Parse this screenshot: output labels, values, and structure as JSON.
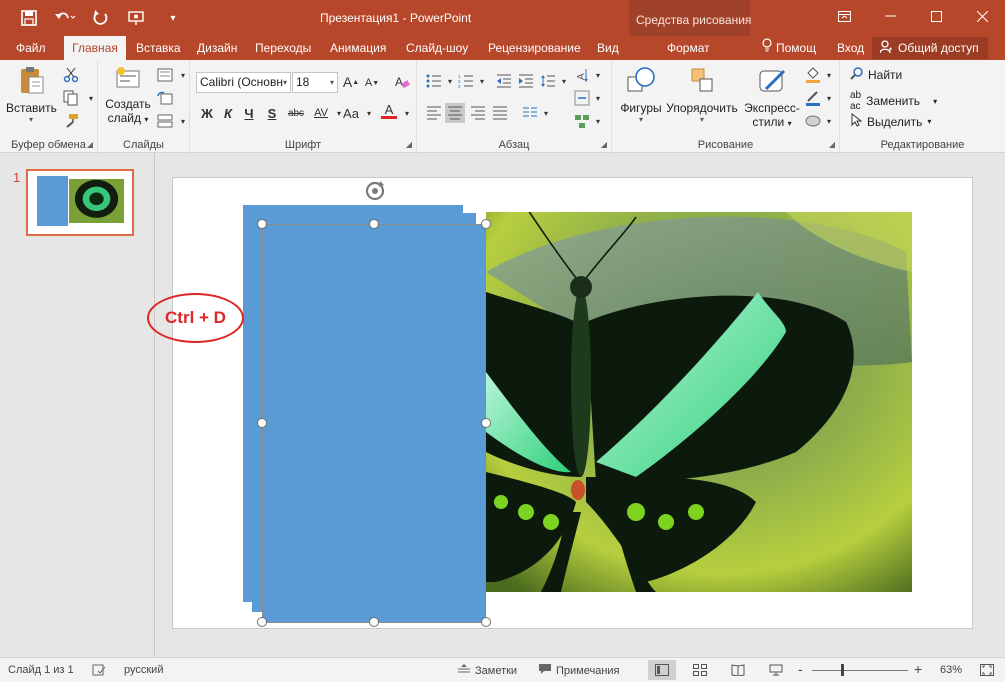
{
  "app": {
    "title": "Презентация1 - PowerPoint",
    "context_group_title": "Средства рисования",
    "accent_color": "#b7472a"
  },
  "qat": {
    "icons": [
      "save-icon",
      "undo-icon",
      "redo-icon",
      "start-from-beginning-icon",
      "customize-qat-icon"
    ]
  },
  "tabs": {
    "file": "Файл",
    "home": "Главная",
    "insert": "Вставка",
    "design": "Дизайн",
    "transitions": "Переходы",
    "animations": "Анимация",
    "slideshow": "Слайд-шоу",
    "review": "Рецензирование",
    "view": "Вид",
    "format": "Формат",
    "help": "Помощ",
    "signin": "Вход",
    "share": "Общий доступ"
  },
  "ribbon": {
    "clipboard": {
      "paste": "Вставить",
      "label": "Буфер обмена"
    },
    "slides": {
      "new_slide_line1": "Создать",
      "new_slide_line2": "слайд",
      "label": "Слайды"
    },
    "font": {
      "font_name": "Calibri (Основн",
      "font_size": "18",
      "bold": "Ж",
      "italic": "К",
      "underline": "Ч",
      "shadow": "S",
      "strike": "abc",
      "spacing": "AV",
      "case": "Aa",
      "grow": "A",
      "shrink": "A",
      "color": "A",
      "label": "Шрифт"
    },
    "paragraph": {
      "label": "Абзац"
    },
    "drawing": {
      "shapes": "Фигуры",
      "arrange": "Упорядочить",
      "styles_line1": "Экспресс-",
      "styles_line2": "стили",
      "label": "Рисование"
    },
    "editing": {
      "find": "Найти",
      "replace": "Заменить",
      "select": "Выделить",
      "label": "Редактирование"
    }
  },
  "thumbnails": [
    {
      "number": "1"
    }
  ],
  "slide": {
    "annotation": "Ctrl + D",
    "shape_color": "#5b9bd5"
  },
  "statusbar": {
    "slide_info": "Слайд 1 из 1",
    "language": "русский",
    "notes": "Заметки",
    "comments": "Примечания",
    "zoom_minus": "-",
    "zoom_plus": "+",
    "zoom_level": "63%"
  }
}
